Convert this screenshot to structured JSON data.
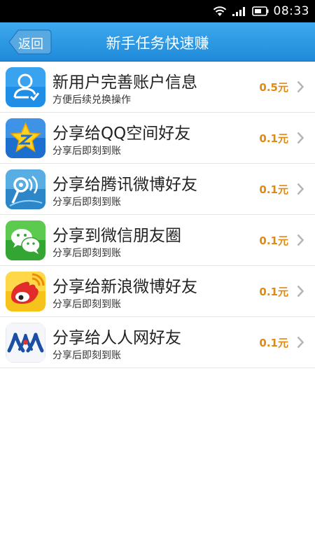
{
  "status_bar": {
    "time": "08:33",
    "icons": [
      "wifi-icon",
      "signal-icon",
      "battery-icon"
    ]
  },
  "nav": {
    "back_label": "返回",
    "title": "新手任务快速赚",
    "colors": {
      "bar": "#2a95e0",
      "back_button": "#5aa8df"
    }
  },
  "tasks": [
    {
      "icon": "user-profile-icon",
      "title": "新用户完善账户信息",
      "subtitle": "方便后续兑换操作",
      "reward": "0.5元"
    },
    {
      "icon": "qzone-icon",
      "title": "分享给QQ空间好友",
      "subtitle": "分享后即刻到账",
      "reward": "0.1元"
    },
    {
      "icon": "tencent-weibo-icon",
      "title": "分享给腾讯微博好友",
      "subtitle": "分享后即刻到账",
      "reward": "0.1元"
    },
    {
      "icon": "wechat-moments-icon",
      "title": "分享到微信朋友圈",
      "subtitle": "分享后即刻到账",
      "reward": "0.1元"
    },
    {
      "icon": "sina-weibo-icon",
      "title": "分享给新浪微博好友",
      "subtitle": "分享后即刻到账",
      "reward": "0.1元"
    },
    {
      "icon": "renren-icon",
      "title": "分享给人人网好友",
      "subtitle": "分享后即刻到账",
      "reward": "0.1元"
    }
  ],
  "colors": {
    "reward": "#e08a12",
    "divider": "#e4e4e4"
  }
}
